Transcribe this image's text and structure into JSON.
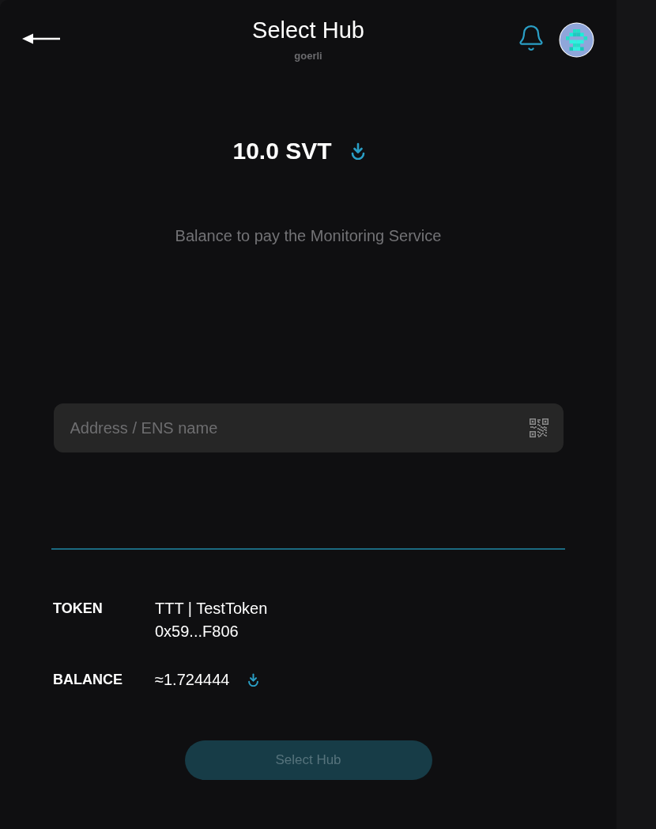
{
  "header": {
    "title": "Select Hub",
    "network": "goerli"
  },
  "balance": {
    "amount": "10.0 SVT",
    "caption": "Balance to pay the Monitoring Service"
  },
  "address_field": {
    "placeholder": "Address / ENS name"
  },
  "details": [
    {
      "label": "TOKEN",
      "lines": [
        "TTT | TestToken",
        "0x59...F806"
      ],
      "kind": "text"
    },
    {
      "label": "BALANCE",
      "lines": [
        "≈1.724444"
      ],
      "kind": "download"
    }
  ],
  "button": {
    "label": "Select Hub",
    "disabled": true
  }
}
